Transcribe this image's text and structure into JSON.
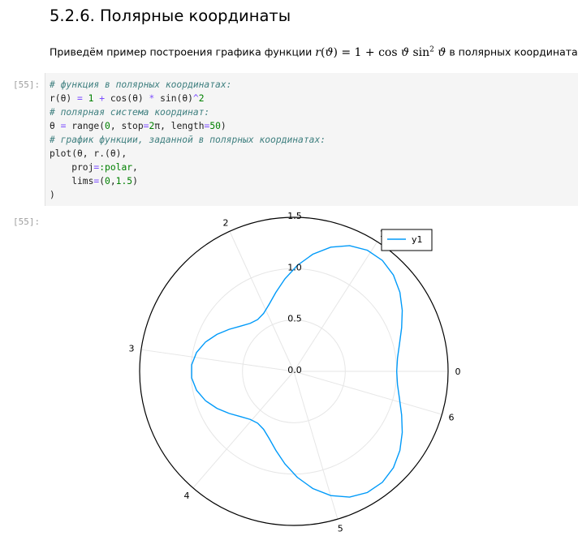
{
  "heading": "5.2.6. Полярные координаты",
  "intro": {
    "prefix": "Приведём пример построения графика функции",
    "formula": "r(ϑ) = 1 + cos ϑ sin² ϑ",
    "suffix": "в полярных координатах"
  },
  "input_prompt": "[55]:",
  "output_prompt": "[55]:",
  "code": {
    "line1": "# функция в полярных координатах:",
    "line2": "r(θ) = 1 + cos(θ) * sin(θ)^2",
    "line3": "# полярная система координат:",
    "line4": "θ = range(0, stop=2π, length=50)",
    "line5": "# график функции, заданной в полярных координатах:",
    "line6": "plot(θ, r.(θ),",
    "line7": "    proj=:polar,",
    "line8": "    lims=(0,1.5)",
    "line9": ")"
  },
  "chart_data": {
    "type": "line",
    "projection": "polar",
    "title": "",
    "series": [
      {
        "name": "y1",
        "color": "#009af9",
        "function": "r(θ) = 1 + cos(θ)·sin(θ)^2",
        "theta_start": 0,
        "theta_stop": 6.283185307,
        "points": 50
      }
    ],
    "rlim": [
      0,
      1.5
    ],
    "radial_ticks": [
      "0.0",
      "0.5",
      "1.0",
      "1.5"
    ],
    "angular_ticks": [
      "0",
      "1",
      "2",
      "3",
      "4",
      "5",
      "6"
    ],
    "legend": {
      "position": "top-right",
      "entries": [
        "y1"
      ]
    },
    "grid": true
  }
}
